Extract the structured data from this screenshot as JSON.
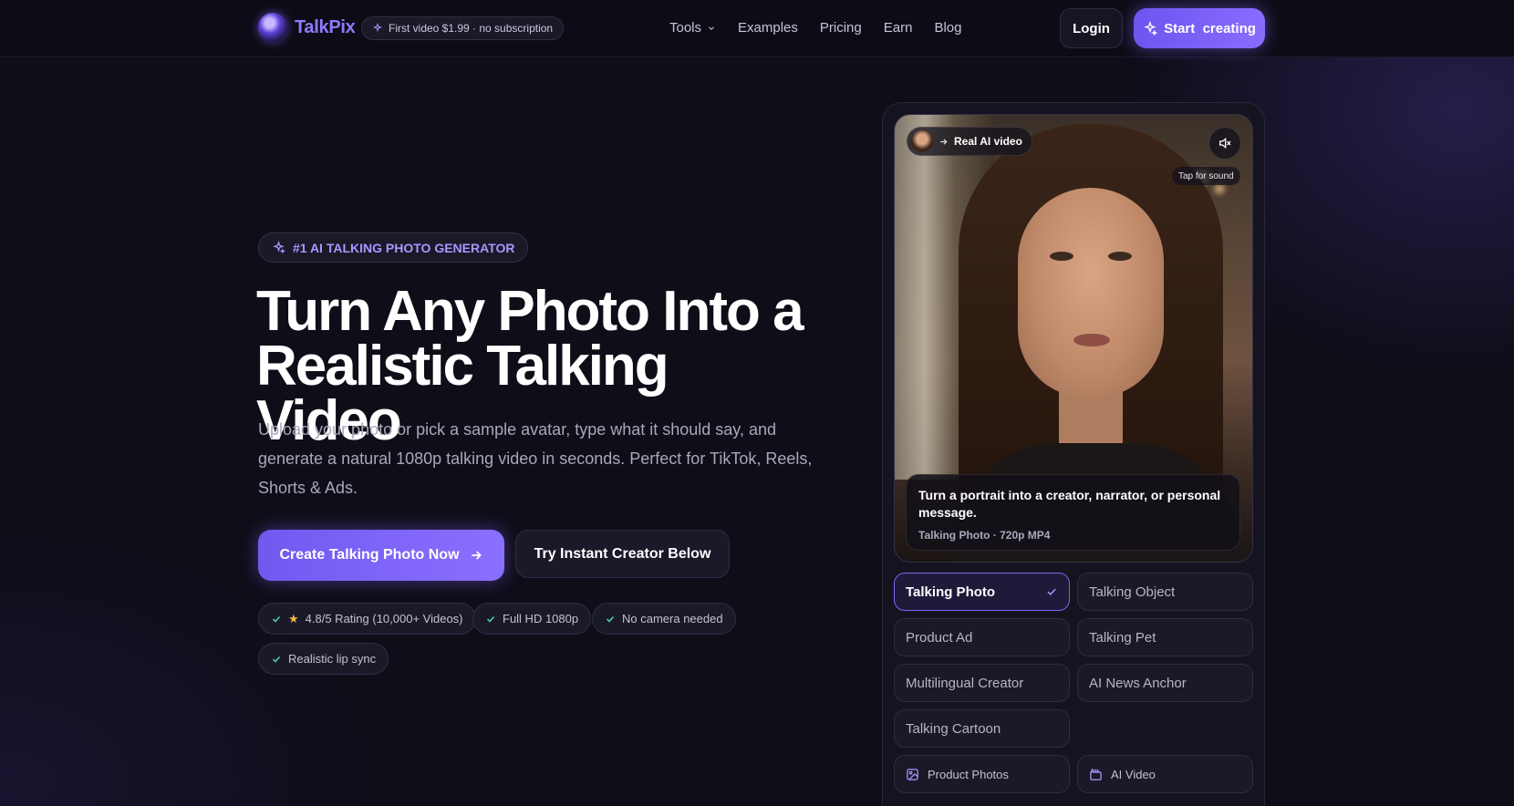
{
  "nav": {
    "brand": "TalkPix",
    "promo": "First video $1.99 · no subscription",
    "links": [
      "Tools",
      "Examples",
      "Pricing",
      "Earn",
      "Blog"
    ],
    "login": "Login",
    "start": "Start  creating"
  },
  "hero": {
    "badge": "#1 AI TALKING PHOTO GENERATOR",
    "headline": "Turn Any Photo Into a Realistic Talking Video",
    "subtext": "Upload your photo or pick a sample avatar, type what it should say, and generate a natural 1080p talking video in seconds. Perfect for TikTok, Reels, Shorts & Ads.",
    "cta_primary": "Create Talking Photo Now",
    "cta_secondary": "Try Instant Creator Below",
    "chips": [
      "4.8/5 Rating (10,000+ Videos)",
      "Full HD 1080p",
      "No camera needed",
      "Realistic lip sync"
    ]
  },
  "preview": {
    "pill": "Real AI video",
    "tap": "Tap for sound",
    "caption_title": "Turn a portrait into a creator, narrator, or personal message.",
    "caption_meta": "Talking Photo · 720p MP4",
    "options": [
      "Talking Photo",
      "Talking Object",
      "Product Ad",
      "Talking Pet",
      "Multilingual Creator",
      "AI News Anchor",
      "Talking Cartoon"
    ],
    "extra": [
      "Product Photos",
      "AI Video"
    ]
  },
  "colors": {
    "accent": "#8a6cff",
    "background": "#0e0d18",
    "check": "#4fd1a5",
    "star": "#f5b83d"
  }
}
